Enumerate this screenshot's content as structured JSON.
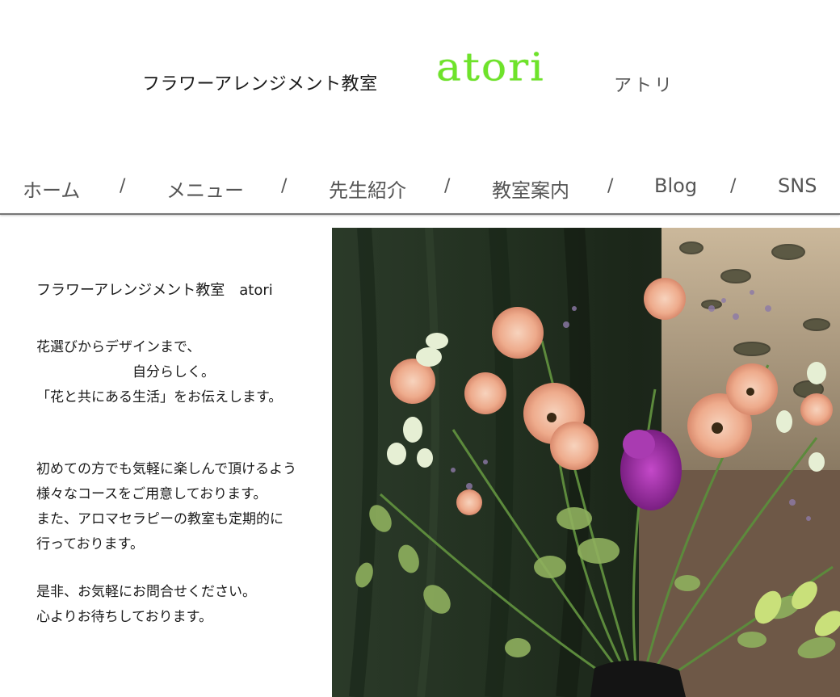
{
  "header": {
    "school_name": "フラワーアレンジメント教室",
    "logo_text": "atori",
    "kana": "アトリ",
    "logo_color": "#6ee32a"
  },
  "nav": {
    "items": [
      {
        "label": "ホーム"
      },
      {
        "label": "メニュー"
      },
      {
        "label": "先生紹介"
      },
      {
        "label": "教室案内"
      },
      {
        "label": "Blog"
      },
      {
        "label": "SNS"
      }
    ],
    "separator": "/"
  },
  "intro": {
    "title": "フラワーアレンジメント教室　atori",
    "paragraph1": [
      "花選びからデザインまで、",
      "　　　　　　　自分らしく。",
      "「花と共にある生活」をお伝えします。"
    ],
    "paragraph2": [
      "初めての方でも気軽に楽しんで頂けるよう",
      "様々なコースをご用意しております。",
      "また、アロマセラピーの教室も定期的に",
      "行っております。"
    ],
    "paragraph3": [
      "是非、お気軽にお問合せください。",
      "心よりお待ちしております。"
    ]
  }
}
